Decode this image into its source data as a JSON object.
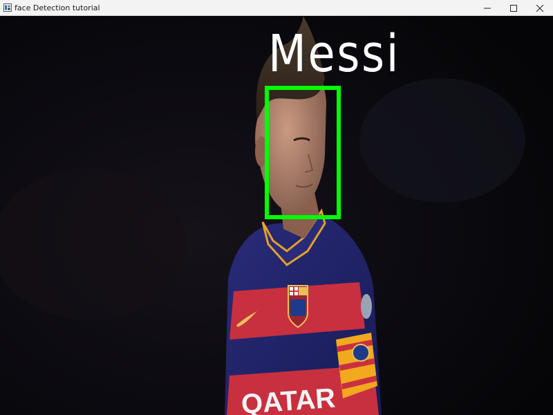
{
  "window": {
    "title": "face Detection tutorial",
    "app_icon": "opencv-window-icon",
    "controls": {
      "minimize": "minimize-icon",
      "maximize": "maximize-icon",
      "close": "close-icon"
    }
  },
  "detection": {
    "label": "Messi",
    "box_color": "#00ff00",
    "label_color": "#ffffff"
  },
  "photo": {
    "jersey_sponsor": "QATAR"
  }
}
